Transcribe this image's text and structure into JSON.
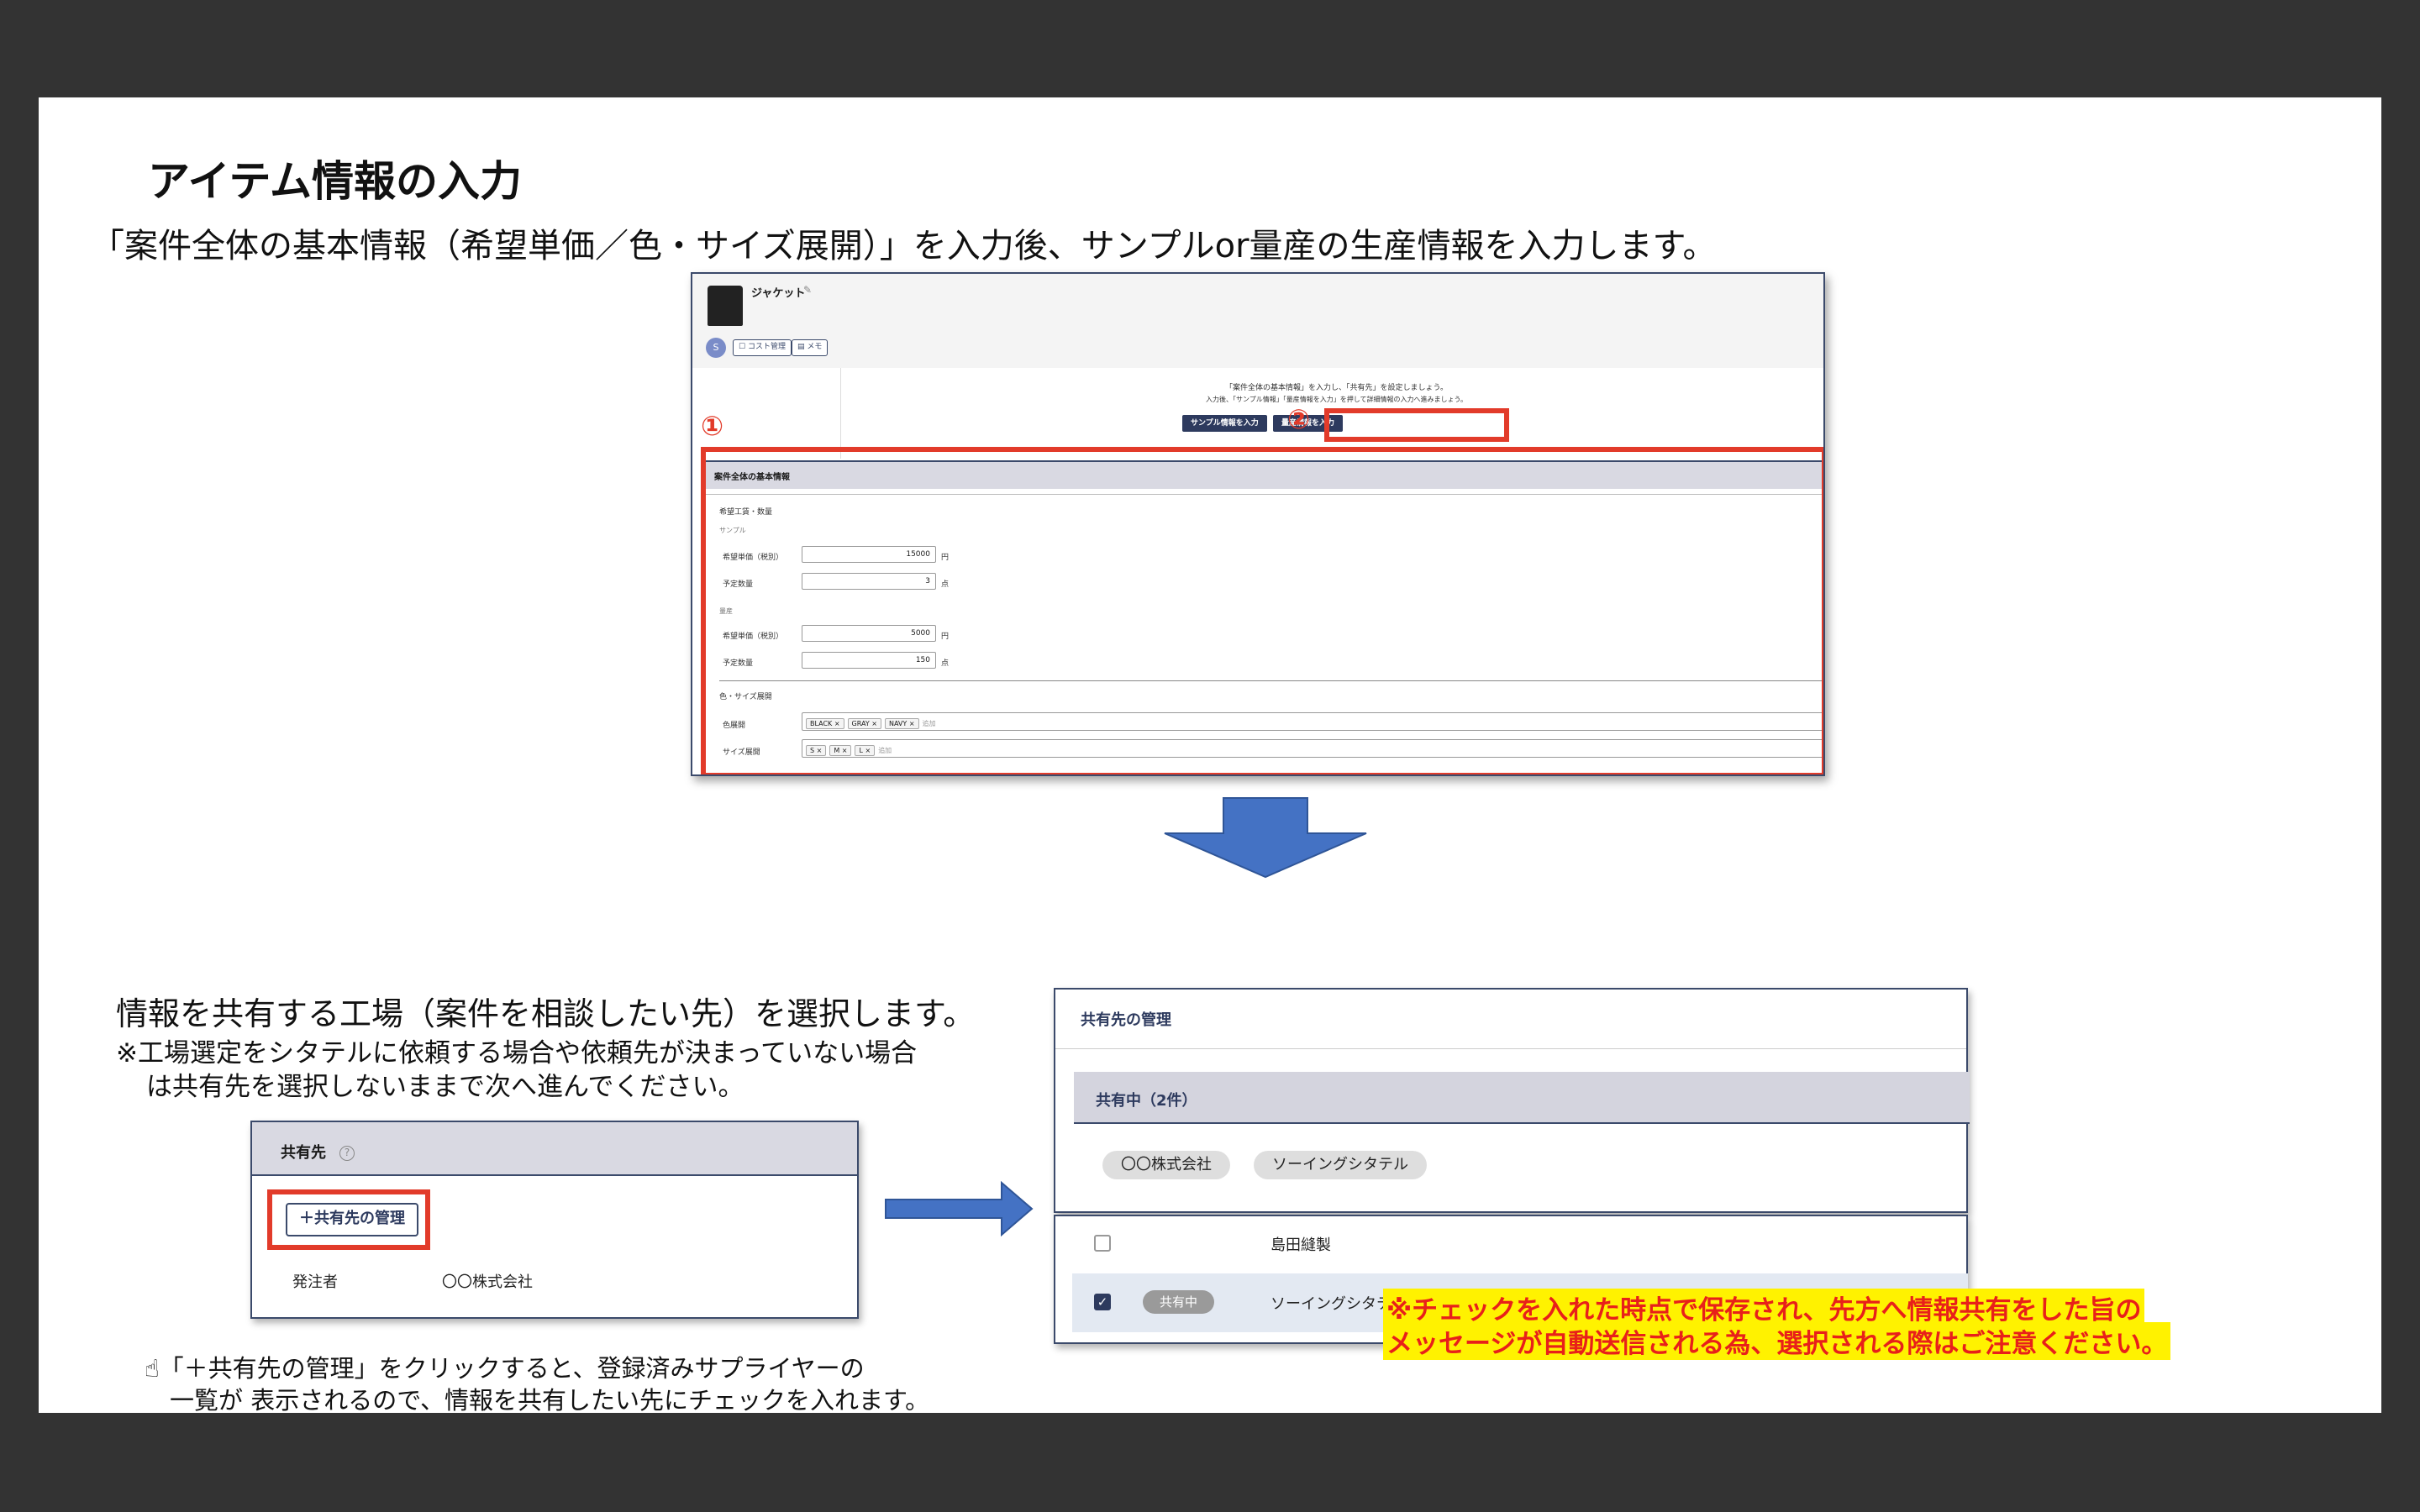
{
  "slide": {
    "title": "アイテム情報の入力",
    "intro": "「案件全体の基本情報（希望単価／色・サイズ展開）」を入力後、サンプルor量産の生産情報を入力します。"
  },
  "screenshot1": {
    "product_name": "ジャケット",
    "mini_buttons": [
      "コスト管理",
      "メモ"
    ],
    "message_line1": "「案件全体の基本情報」を入力し、「共有先」を設定しましょう。",
    "message_line2": "入力後、「サンプル情報」「量産情報を入力」を押して詳細情報の入力へ進みましょう。",
    "buttons": [
      "サンプル情報を入力",
      "量産情報を入力"
    ],
    "marker1": "①",
    "marker2": "②",
    "section_title": "案件全体の基本情報",
    "group_label": "希望工賃・数量",
    "sample_label": "サンプル",
    "mass_label": "量産",
    "price_label": "希望単価（税別）",
    "qty_label": "予定数量",
    "sample_price": "15000",
    "sample_qty": "3",
    "mass_price": "5000",
    "mass_qty": "150",
    "unit_yen": "円",
    "unit_pcs": "点",
    "color_size_label": "色・サイズ展開",
    "color_label": "色展開",
    "size_label": "サイズ展開",
    "colors": [
      "BLACK ×",
      "GRAY ×",
      "NAVY ×"
    ],
    "sizes": [
      "S ×",
      "M ×",
      "L ×"
    ],
    "add_text": "追加"
  },
  "share_section": {
    "heading": "情報を共有する工場（案件を相談したい先）を選択します。",
    "note_line1": "※工場選定をシタテルに依頼する場合や依頼先が決まっていない場合",
    "note_line2": "は共有先を選択しないままで次へ進んでください。"
  },
  "panel_small": {
    "title": "共有先",
    "help_icon": "?",
    "manage_button": "＋共有先の管理",
    "orderer_label": "発注者",
    "orderer_value": "〇〇株式会社"
  },
  "tip": {
    "line1": "「＋共有先の管理」をクリックすると、登録済みサプライヤーの",
    "line2": "一覧が 表示されるので、情報を共有したい先にチェックを入れます。",
    "icon": "pointer-hand-icon"
  },
  "panel_manage": {
    "title": "共有先の管理",
    "sharing_band": "共有中（2件）",
    "pills": [
      "〇〇株式会社",
      "ソーイングシタテル"
    ],
    "rows": [
      {
        "name": "島田縫製",
        "checked": false,
        "badge": ""
      },
      {
        "name": "ソーイングシタテル",
        "checked": true,
        "badge": "共有中"
      }
    ]
  },
  "warning": {
    "line1": "※チェックを入れた時点で保存され、先方へ情報共有をした旨の",
    "line2": "メッセージが自動送信される為、選択される際はご注意ください。"
  },
  "colors": {
    "accent_red": "#e23b2a",
    "navy": "#2d3a5e",
    "arrow_blue": "#4472c4",
    "highlight_yellow": "#fff200"
  }
}
